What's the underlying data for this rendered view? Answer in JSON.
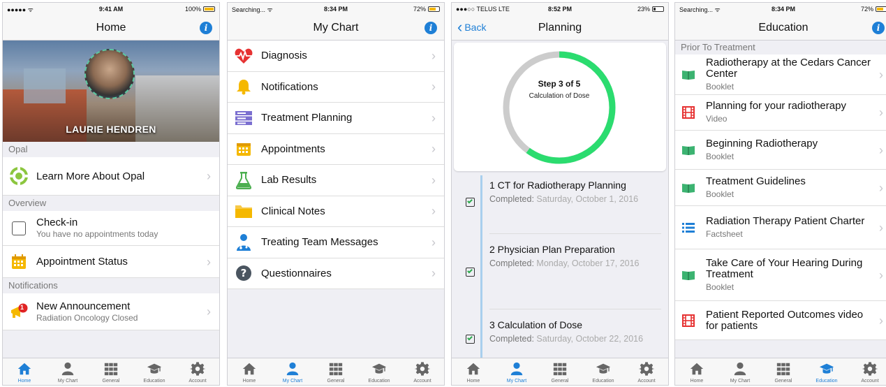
{
  "tabs": [
    {
      "label": "Home",
      "icon": "home-icon"
    },
    {
      "label": "My Chart",
      "icon": "person-icon"
    },
    {
      "label": "General",
      "icon": "grid-icon"
    },
    {
      "label": "Education",
      "icon": "graduation-cap-icon"
    },
    {
      "label": "Account",
      "icon": "gear-icon"
    }
  ],
  "colors": {
    "accent": "#1e7fd6",
    "progress": "#2bdc6f",
    "progress_track": "#cccccc",
    "timeline": "#a9cfee"
  },
  "home": {
    "status": {
      "carrier": "●●●●● ᯤ",
      "time": "9:41 AM",
      "battery": "100%",
      "battery_level": 1.0
    },
    "title": "Home",
    "patient_name": "LAURIE HENDREN",
    "section_opal": "Opal",
    "learn_more": "Learn More About Opal",
    "section_overview": "Overview",
    "checkin_title": "Check-in",
    "checkin_sub": "You have no appointments today",
    "appointment_status": "Appointment Status",
    "section_notifications": "Notifications",
    "notification_title": "New Announcement",
    "notification_sub": "Radiation Oncology Closed",
    "notification_badge": "1",
    "active_tab": 0
  },
  "mychart": {
    "status": {
      "carrier": "Searching... ᯤ",
      "time": "8:34 PM",
      "battery": "72%",
      "battery_level": 0.72
    },
    "title": "My Chart",
    "items": [
      {
        "label": "Diagnosis",
        "icon": "heartbeat-icon"
      },
      {
        "label": "Notifications",
        "icon": "bell-icon"
      },
      {
        "label": "Treatment Planning",
        "icon": "server-icon"
      },
      {
        "label": "Appointments",
        "icon": "calendar-icon"
      },
      {
        "label": "Lab Results",
        "icon": "flask-icon"
      },
      {
        "label": "Clinical Notes",
        "icon": "folder-icon"
      },
      {
        "label": "Treating Team Messages",
        "icon": "doctor-icon"
      },
      {
        "label": "Questionnaires",
        "icon": "question-icon"
      }
    ],
    "active_tab": 1
  },
  "planning": {
    "status": {
      "carrier": "●●●○○ TELUS  LTE",
      "time": "8:52 PM",
      "battery": "23%",
      "battery_level": 0.23
    },
    "title": "Planning",
    "back_label": "Back",
    "step_text": "Step 3 of 5",
    "step_name": "Calculation of Dose",
    "progress_fraction": 0.6,
    "steps": [
      {
        "title": "1 CT for Radiotherapy Planning",
        "label": "Completed:",
        "date": "Saturday, October 1, 2016"
      },
      {
        "title": "2 Physician Plan Preparation",
        "label": "Completed:",
        "date": "Monday, October 17, 2016"
      },
      {
        "title": "3 Calculation of Dose",
        "label": "Completed:",
        "date": "Saturday, October 22, 2016"
      }
    ],
    "active_tab": 1
  },
  "education": {
    "status": {
      "carrier": "Searching... ᯤ",
      "time": "8:34 PM",
      "battery": "72%",
      "battery_level": 0.72
    },
    "title": "Education",
    "section": "Prior To Treatment",
    "items": [
      {
        "title": "Radiotherapy at the Cedars Cancer Center",
        "type": "Booklet",
        "icon": "book-icon"
      },
      {
        "title": "Planning for your radiotherapy",
        "type": "Video",
        "icon": "film-icon"
      },
      {
        "title": "Beginning Radiotherapy",
        "type": "Booklet",
        "icon": "book-icon"
      },
      {
        "title": "Treatment Guidelines",
        "type": "Booklet",
        "icon": "book-icon"
      },
      {
        "title": "Radiation Therapy Patient Charter",
        "type": "Factsheet",
        "icon": "list-icon"
      },
      {
        "title": "Take Care of Your Hearing During Treatment",
        "type": "Booklet",
        "icon": "book-icon"
      },
      {
        "title": "Patient Reported Outcomes video for patients",
        "type": "",
        "icon": "film-icon"
      }
    ],
    "active_tab": 3
  }
}
